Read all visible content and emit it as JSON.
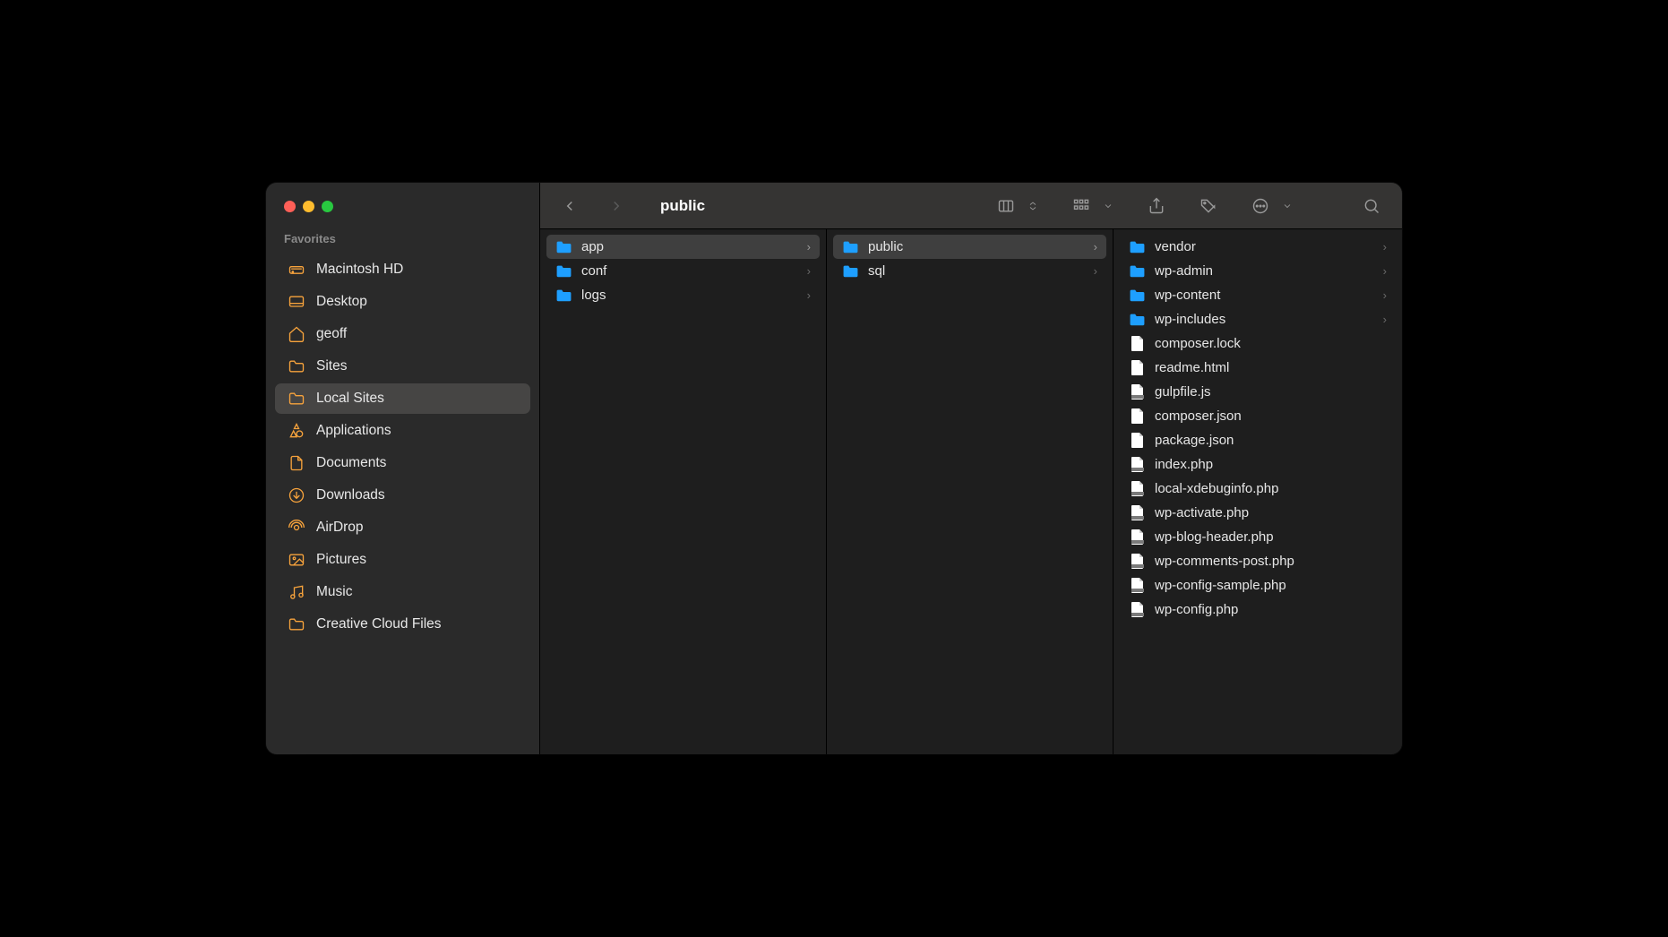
{
  "window": {
    "title": "public"
  },
  "sidebar": {
    "section_label": "Favorites",
    "items": [
      {
        "label": "Macintosh HD",
        "icon": "hdd"
      },
      {
        "label": "Desktop",
        "icon": "desktop"
      },
      {
        "label": "geoff",
        "icon": "home"
      },
      {
        "label": "Sites",
        "icon": "folder"
      },
      {
        "label": "Local Sites",
        "icon": "folder",
        "selected": true
      },
      {
        "label": "Applications",
        "icon": "app"
      },
      {
        "label": "Documents",
        "icon": "doc"
      },
      {
        "label": "Downloads",
        "icon": "download"
      },
      {
        "label": "AirDrop",
        "icon": "airdrop"
      },
      {
        "label": "Pictures",
        "icon": "pictures"
      },
      {
        "label": "Music",
        "icon": "music"
      },
      {
        "label": "Creative Cloud Files",
        "icon": "folder"
      }
    ]
  },
  "columns": [
    {
      "items": [
        {
          "label": "app",
          "type": "folder",
          "selected": true,
          "expandable": true
        },
        {
          "label": "conf",
          "type": "folder",
          "expandable": true
        },
        {
          "label": "logs",
          "type": "folder",
          "expandable": true
        }
      ]
    },
    {
      "items": [
        {
          "label": "public",
          "type": "folder",
          "selected": true,
          "expandable": true
        },
        {
          "label": "sql",
          "type": "folder",
          "expandable": true
        }
      ]
    },
    {
      "items": [
        {
          "label": "vendor",
          "type": "folder",
          "expandable": true
        },
        {
          "label": "wp-admin",
          "type": "folder",
          "expandable": true
        },
        {
          "label": "wp-content",
          "type": "folder",
          "expandable": true
        },
        {
          "label": "wp-includes",
          "type": "folder",
          "expandable": true
        },
        {
          "label": "composer.lock",
          "type": "file"
        },
        {
          "label": "readme.html",
          "type": "file"
        },
        {
          "label": "gulpfile.js",
          "type": "file-js"
        },
        {
          "label": "composer.json",
          "type": "file"
        },
        {
          "label": "package.json",
          "type": "file"
        },
        {
          "label": "index.php",
          "type": "file-php"
        },
        {
          "label": "local-xdebuginfo.php",
          "type": "file-php"
        },
        {
          "label": "wp-activate.php",
          "type": "file-php"
        },
        {
          "label": "wp-blog-header.php",
          "type": "file-php"
        },
        {
          "label": "wp-comments-post.php",
          "type": "file-php"
        },
        {
          "label": "wp-config-sample.php",
          "type": "file-php"
        },
        {
          "label": "wp-config.php",
          "type": "file-php"
        }
      ]
    }
  ]
}
